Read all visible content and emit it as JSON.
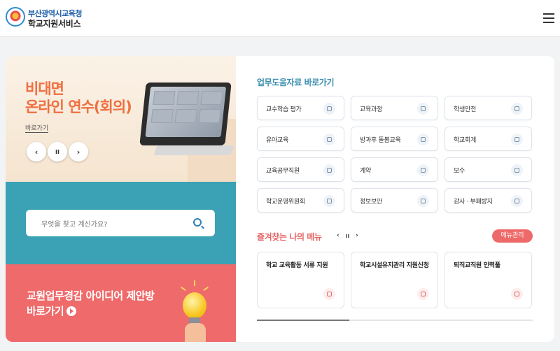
{
  "header": {
    "org_name": "부산광역시교육청",
    "service_name": "학교지원서비스",
    "menu_icon": "hamburger-icon"
  },
  "hero": {
    "title": "비대면\n온라인 연수(회의)",
    "link": "바로가기",
    "prev": "‹",
    "pause": "II",
    "next": "›"
  },
  "search": {
    "placeholder": "무엇을 찾고 계신가요?",
    "icon": "search-icon"
  },
  "idea_banner": {
    "line1": "교원업무경감 아이디어 제안방",
    "line2": "바로가기"
  },
  "quick_links": {
    "title": "업무도움자료 바로가기",
    "items": [
      {
        "label": "교수학습 평가",
        "icon": "id-card-icon"
      },
      {
        "label": "교육과정",
        "icon": "pencil-icon"
      },
      {
        "label": "학생안전",
        "icon": "shield-icon"
      },
      {
        "label": "유아교육",
        "icon": "badge-icon"
      },
      {
        "label": "방과후 돌봄교육",
        "icon": "book-icon"
      },
      {
        "label": "학교회계",
        "icon": "ledger-icon"
      },
      {
        "label": "교육공무직원",
        "icon": "chat-icon"
      },
      {
        "label": "계약",
        "icon": "check-circle-icon"
      },
      {
        "label": "보수",
        "icon": "lock-icon"
      },
      {
        "label": "학교운영위원회",
        "icon": "document-icon"
      },
      {
        "label": "정보보안",
        "icon": "padlock-icon"
      },
      {
        "label": "감사 · 부패방지",
        "icon": "medal-icon"
      }
    ]
  },
  "favorites": {
    "title": "즐겨찾는 나의 메뉴",
    "prev": "‹",
    "pause": "II",
    "next": "›",
    "manage_label": "메뉴관리",
    "items": [
      {
        "label": "학교 교육활동 서류 지원",
        "icon": "clipboard-icon"
      },
      {
        "label": "학교시설유지관리 지원신청",
        "icon": "edit-icon"
      },
      {
        "label": "퇴직교직원 인력풀",
        "icon": "message-icon"
      }
    ]
  },
  "colors": {
    "accent_blue": "#3c8fb0",
    "accent_red": "#ee6a6a",
    "hero_orange": "#ef6f3f",
    "search_band": "#3aa2b4"
  }
}
